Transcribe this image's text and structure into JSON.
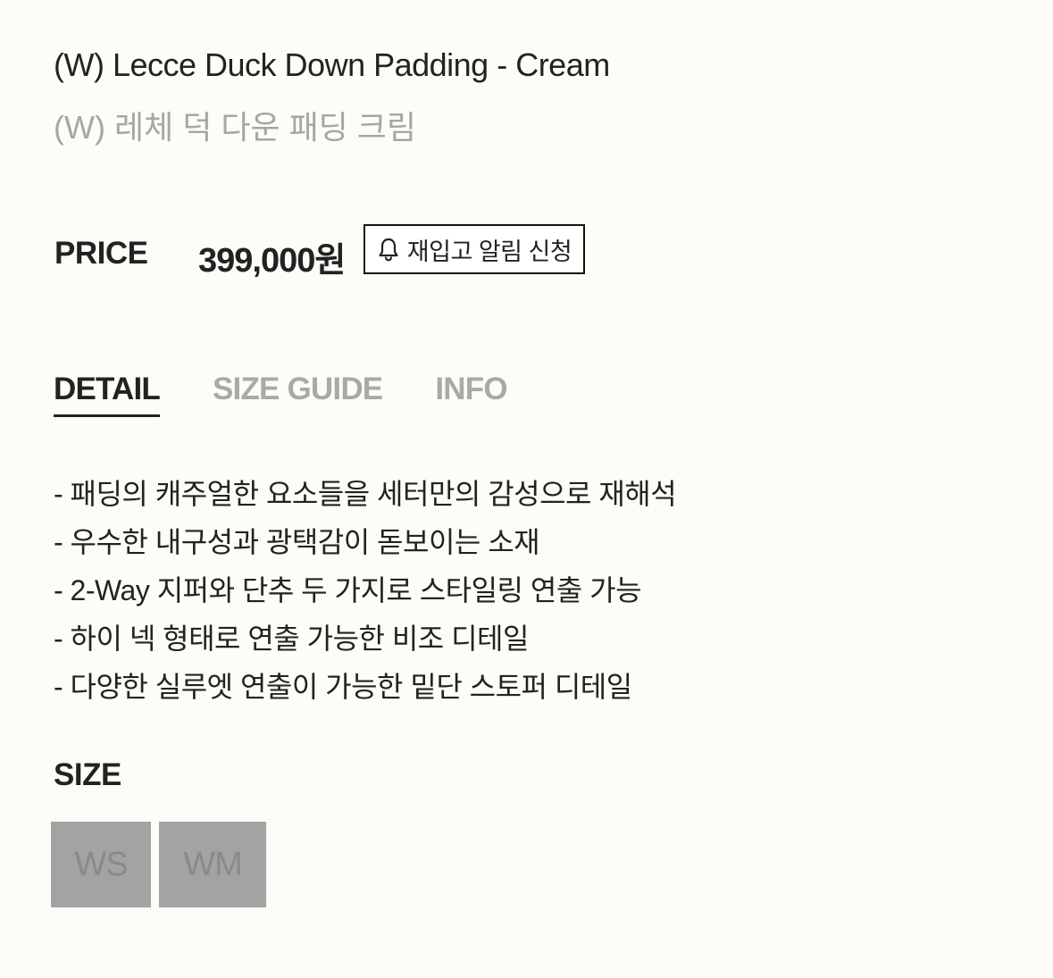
{
  "product": {
    "name_en": "(W) Lecce Duck Down Padding - Cream",
    "name_ko": "(W) 레체 덕 다운 패딩 크림"
  },
  "price": {
    "label": "PRICE",
    "value": "399,000원",
    "restock_button": {
      "icon": "bell-icon",
      "label": "재입고 알림 신청"
    }
  },
  "tabs": [
    {
      "label": "DETAIL",
      "active": true
    },
    {
      "label": "SIZE GUIDE",
      "active": false
    },
    {
      "label": "INFO",
      "active": false
    }
  ],
  "details": [
    "- 패딩의 캐주얼한 요소들을 세터만의 감성으로 재해석",
    "- 우수한 내구성과 광택감이 돋보이는 소재",
    "- 2-Way 지퍼와 단추 두 가지로 스타일링 연출 가능",
    "- 하이 넥 형태로 연출 가능한 비조 디테일",
    "- 다양한 실루엣 연출이 가능한 밑단 스토퍼 디테일"
  ],
  "size": {
    "label": "SIZE",
    "options": [
      {
        "label": "WS",
        "available": false
      },
      {
        "label": "WM",
        "available": false
      }
    ]
  },
  "colors": {
    "background": "#fdfcf7",
    "text": "#222222",
    "muted": "#a9a9a9",
    "size_disabled_bg": "#a3a3a3"
  }
}
